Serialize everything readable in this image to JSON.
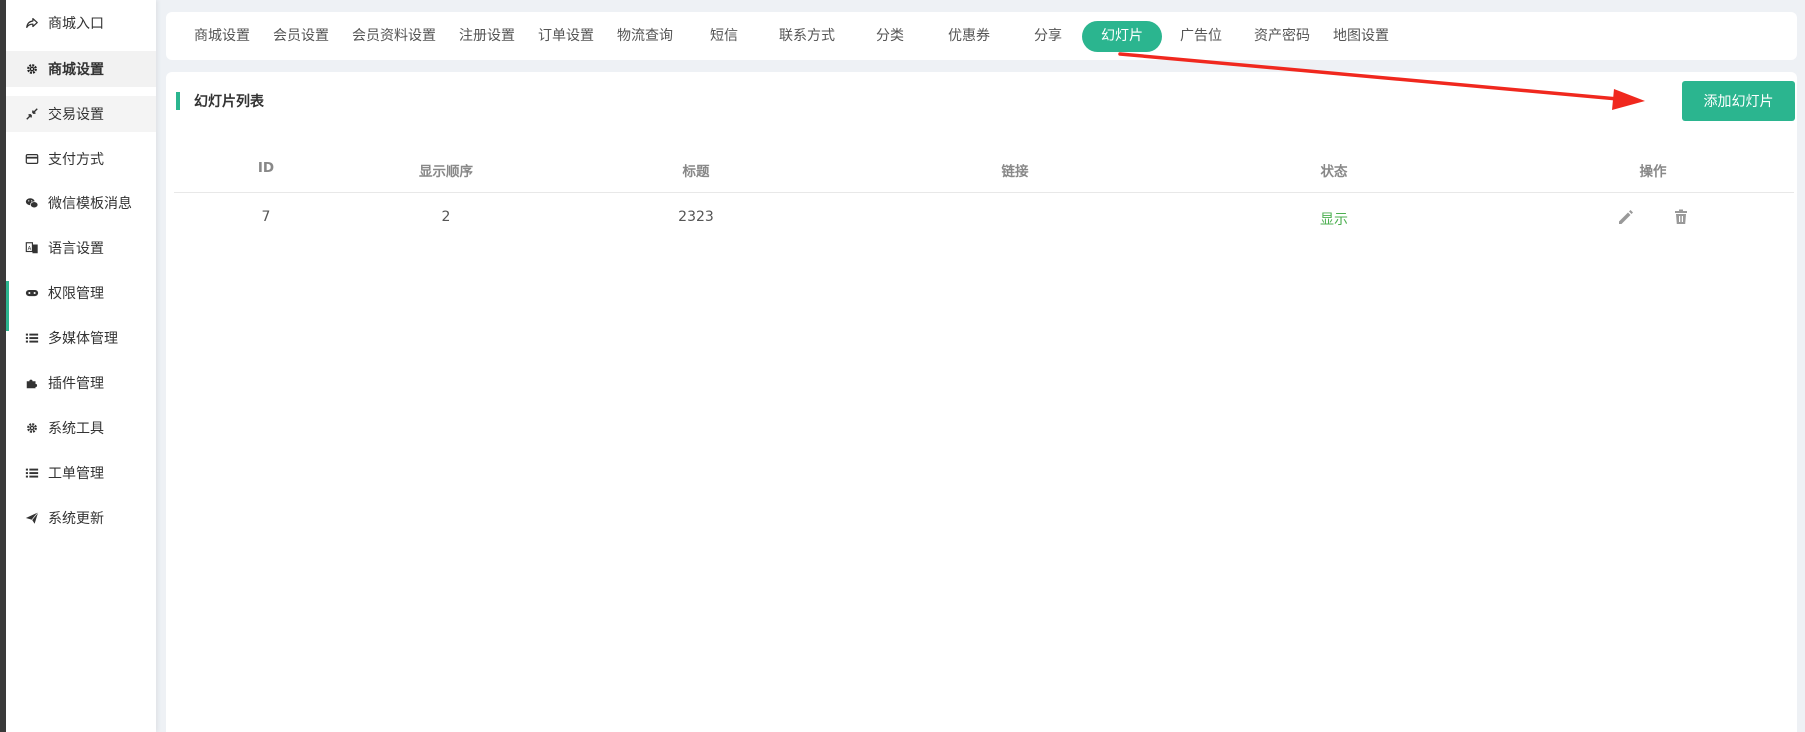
{
  "sidebar": {
    "items": [
      {
        "label": "商城入口",
        "icon": "share-icon"
      },
      {
        "label": "商城设置",
        "icon": "gear-icon"
      },
      {
        "label": "交易设置",
        "icon": "compress-icon"
      },
      {
        "label": "支付方式",
        "icon": "credit-card-icon"
      },
      {
        "label": "微信模板消息",
        "icon": "wechat-icon"
      },
      {
        "label": "语言设置",
        "icon": "translate-icon"
      },
      {
        "label": "权限管理",
        "icon": "gamepad-icon"
      },
      {
        "label": "多媒体管理",
        "icon": "list-icon"
      },
      {
        "label": "插件管理",
        "icon": "puzzle-icon"
      },
      {
        "label": "系统工具",
        "icon": "gear-icon"
      },
      {
        "label": "工单管理",
        "icon": "list-icon"
      },
      {
        "label": "系统更新",
        "icon": "send-icon"
      }
    ]
  },
  "tabs": [
    {
      "label": "商城设置"
    },
    {
      "label": "会员设置"
    },
    {
      "label": "会员资料设置"
    },
    {
      "label": "注册设置"
    },
    {
      "label": "订单设置"
    },
    {
      "label": "物流查询"
    },
    {
      "label": "短信"
    },
    {
      "label": "联系方式"
    },
    {
      "label": "分类"
    },
    {
      "label": "优惠券"
    },
    {
      "label": "分享"
    },
    {
      "label": "幻灯片"
    },
    {
      "label": "广告位"
    },
    {
      "label": "资产密码"
    },
    {
      "label": "地图设置"
    }
  ],
  "panel": {
    "title": "幻灯片列表",
    "add_button": "添加幻灯片"
  },
  "table": {
    "columns": [
      "ID",
      "显示顺序",
      "标题",
      "链接",
      "状态",
      "操作"
    ],
    "rows": [
      {
        "id": "7",
        "order": "2",
        "title": "2323",
        "link": "",
        "status": "显示"
      }
    ]
  },
  "colors": {
    "accent": "#2bb58f",
    "status_shown": "#4caf50",
    "annotation_arrow": "#f0281e"
  }
}
